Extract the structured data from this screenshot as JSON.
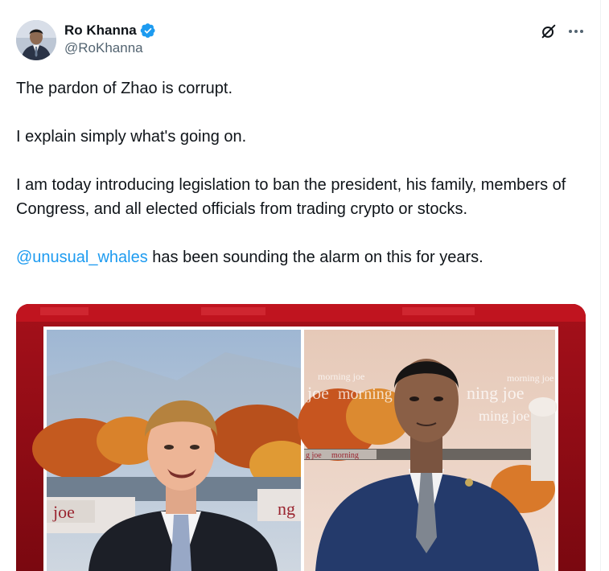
{
  "author": {
    "display_name": "Ro Khanna",
    "handle": "@RoKhanna",
    "verified": true
  },
  "tweet": {
    "line1": "The pardon of Zhao is corrupt.",
    "line2": "I explain simply what's going on.",
    "line3": "I am today introducing legislation to ban the president, his family, members of Congress, and all elected officials from trading crypto or stocks.",
    "mention": "@unusual_whales",
    "line4_rest": " has been sounding the alarm on this for years."
  },
  "media": {
    "screen_text_left": "joe",
    "screen_text_left_2": "ng",
    "screen_text_right_1": "joe",
    "screen_text_right_2": "morning",
    "screen_text_right_3": "ning joe",
    "screen_text_right_4": "morning joe",
    "screen_text_right_5": "morning joe",
    "screen_text_right_6": "morning",
    "screen_text_right_7": "ming joe",
    "screen_text_right_8": "g joe"
  },
  "colors": {
    "link": "#1d9bf0",
    "verified_badge": "#1d9bf0",
    "frame_red": "#8c0a10",
    "text_primary": "#0f1419",
    "text_secondary": "#536471"
  },
  "icons": {
    "grok": "grok-slash-circle-icon",
    "more": "more-horizontal-icon",
    "verified": "verified-badge-icon"
  }
}
